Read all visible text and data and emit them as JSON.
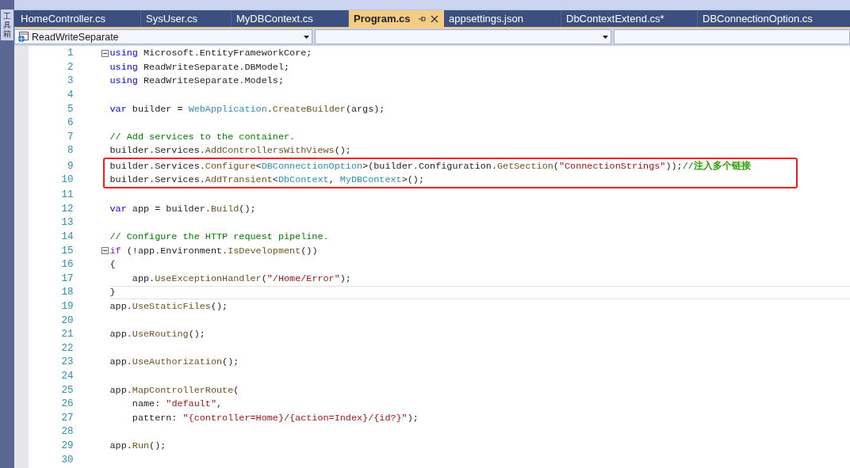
{
  "side_panel": {
    "label": "工具箱"
  },
  "tabs": [
    {
      "label": "HomeController.cs",
      "selected": false
    },
    {
      "label": "SysUser.cs",
      "selected": false
    },
    {
      "label": "MyDBContext.cs",
      "selected": false
    },
    {
      "label": "Program.cs",
      "selected": true
    },
    {
      "label": "appsettings.json",
      "selected": false
    },
    {
      "label": "DbContextExtend.cs*",
      "selected": false
    },
    {
      "label": "DBConnectionOption.cs",
      "selected": false
    }
  ],
  "navigation_bar": {
    "project": "ReadWriteSeparate"
  },
  "blocks": [
    {
      "highlighted": false,
      "lines": [
        {
          "number": "1",
          "fold": true,
          "current": false,
          "tokens": [
            {
              "kind": "keyword",
              "text": "using"
            },
            {
              "kind": "plain",
              "text": " Microsoft.EntityFrameworkCore;"
            }
          ]
        },
        {
          "number": "2",
          "fold": false,
          "current": false,
          "tokens": [
            {
              "kind": "keyword",
              "text": "using"
            },
            {
              "kind": "plain",
              "text": " ReadWriteSeparate.DBModel;"
            }
          ]
        },
        {
          "number": "3",
          "fold": false,
          "current": false,
          "tokens": [
            {
              "kind": "keyword",
              "text": "using"
            },
            {
              "kind": "plain",
              "text": " ReadWriteSeparate.Models;"
            }
          ]
        },
        {
          "number": "4",
          "fold": false,
          "current": false
        },
        {
          "number": "5",
          "fold": false,
          "current": false,
          "tokens": [
            {
              "kind": "keyword",
              "text": "var"
            },
            {
              "kind": "plain",
              "text": " builder = "
            },
            {
              "kind": "type",
              "text": "WebApplication"
            },
            {
              "kind": "plain",
              "text": "."
            },
            {
              "kind": "method",
              "text": "CreateBuilder"
            },
            {
              "kind": "plain",
              "text": "(args);"
            }
          ]
        },
        {
          "number": "6",
          "fold": false,
          "current": false
        },
        {
          "number": "7",
          "fold": false,
          "current": false,
          "tokens": [
            {
              "kind": "comment",
              "text": "// Add services to the container."
            }
          ]
        },
        {
          "number": "8",
          "fold": false,
          "current": false,
          "tokens": [
            {
              "kind": "plain",
              "text": "builder.Services."
            },
            {
              "kind": "method",
              "text": "AddControllersWithViews"
            },
            {
              "kind": "plain",
              "text": "();"
            }
          ]
        }
      ]
    },
    {
      "highlighted": true,
      "lines": [
        {
          "number": "9",
          "fold": false,
          "current": false,
          "tokens": [
            {
              "kind": "plain",
              "text": "builder.Services."
            },
            {
              "kind": "method",
              "text": "Configure"
            },
            {
              "kind": "plain",
              "text": "<"
            },
            {
              "kind": "type",
              "text": "DBConnectionOption"
            },
            {
              "kind": "plain",
              "text": ">(builder.Configuration."
            },
            {
              "kind": "method",
              "text": "GetSection"
            },
            {
              "kind": "plain",
              "text": "("
            },
            {
              "kind": "string",
              "text": "\"ConnectionStrings\""
            },
            {
              "kind": "plain",
              "text": "));"
            },
            {
              "kind": "comment",
              "text": "//"
            },
            {
              "kind": "note",
              "text": "注入多个链接"
            }
          ]
        },
        {
          "number": "10",
          "fold": false,
          "current": false,
          "tokens": [
            {
              "kind": "plain",
              "text": "builder.Services."
            },
            {
              "kind": "method",
              "text": "AddTransient"
            },
            {
              "kind": "plain",
              "text": "<"
            },
            {
              "kind": "type",
              "text": "DbContext"
            },
            {
              "kind": "plain",
              "text": ", "
            },
            {
              "kind": "type",
              "text": "MyDBContext"
            },
            {
              "kind": "plain",
              "text": ">();"
            }
          ]
        }
      ]
    },
    {
      "highlighted": false,
      "lines": [
        {
          "number": "11",
          "fold": false,
          "current": false
        },
        {
          "number": "12",
          "fold": false,
          "current": false,
          "tokens": [
            {
              "kind": "keyword",
              "text": "var"
            },
            {
              "kind": "plain",
              "text": " app = builder."
            },
            {
              "kind": "method",
              "text": "Build"
            },
            {
              "kind": "plain",
              "text": "();"
            }
          ]
        },
        {
          "number": "13",
          "fold": false,
          "current": false
        },
        {
          "number": "14",
          "fold": false,
          "current": false,
          "tokens": [
            {
              "kind": "comment",
              "text": "// Configure the HTTP request pipeline."
            }
          ]
        },
        {
          "number": "15",
          "fold": true,
          "current": false,
          "tokens": [
            {
              "kind": "control",
              "text": "if"
            },
            {
              "kind": "plain",
              "text": " (!app.Environment."
            },
            {
              "kind": "method",
              "text": "IsDevelopment"
            },
            {
              "kind": "plain",
              "text": "())"
            }
          ]
        },
        {
          "number": "16",
          "fold": false,
          "current": false,
          "tokens": [
            {
              "kind": "plain",
              "text": "{"
            }
          ]
        },
        {
          "number": "17",
          "fold": false,
          "current": false,
          "tokens": [
            {
              "kind": "plain",
              "text": "    app."
            },
            {
              "kind": "method",
              "text": "UseExceptionHandler"
            },
            {
              "kind": "plain",
              "text": "("
            },
            {
              "kind": "string",
              "text": "\"/Home/Error\""
            },
            {
              "kind": "plain",
              "text": ");"
            }
          ]
        },
        {
          "number": "18",
          "fold": false,
          "current": true,
          "tokens": [
            {
              "kind": "plain",
              "text": "}"
            }
          ]
        },
        {
          "number": "19",
          "fold": false,
          "current": false,
          "tokens": [
            {
              "kind": "plain",
              "text": "app."
            },
            {
              "kind": "method",
              "text": "UseStaticFiles"
            },
            {
              "kind": "plain",
              "text": "();"
            }
          ]
        },
        {
          "number": "20",
          "fold": false,
          "current": false
        },
        {
          "number": "21",
          "fold": false,
          "current": false,
          "tokens": [
            {
              "kind": "plain",
              "text": "app."
            },
            {
              "kind": "method",
              "text": "UseRouting"
            },
            {
              "kind": "plain",
              "text": "();"
            }
          ]
        },
        {
          "number": "22",
          "fold": false,
          "current": false
        },
        {
          "number": "23",
          "fold": false,
          "current": false,
          "tokens": [
            {
              "kind": "plain",
              "text": "app."
            },
            {
              "kind": "method",
              "text": "UseAuthorization"
            },
            {
              "kind": "plain",
              "text": "();"
            }
          ]
        },
        {
          "number": "24",
          "fold": false,
          "current": false
        },
        {
          "number": "25",
          "fold": false,
          "current": false,
          "tokens": [
            {
              "kind": "plain",
              "text": "app."
            },
            {
              "kind": "method",
              "text": "MapControllerRoute"
            },
            {
              "kind": "plain",
              "text": "("
            }
          ]
        },
        {
          "number": "26",
          "fold": false,
          "current": false,
          "tokens": [
            {
              "kind": "plain",
              "text": "    name: "
            },
            {
              "kind": "string",
              "text": "\"default\""
            },
            {
              "kind": "plain",
              "text": ","
            }
          ]
        },
        {
          "number": "27",
          "fold": false,
          "current": false,
          "tokens": [
            {
              "kind": "plain",
              "text": "    pattern: "
            },
            {
              "kind": "string",
              "text": "\"{controller=Home}/{action=Index}/{id?}\""
            },
            {
              "kind": "plain",
              "text": ");"
            }
          ]
        },
        {
          "number": "28",
          "fold": false,
          "current": false
        },
        {
          "number": "29",
          "fold": false,
          "current": false,
          "tokens": [
            {
              "kind": "plain",
              "text": "app."
            },
            {
              "kind": "method",
              "text": "Run"
            },
            {
              "kind": "plain",
              "text": "();"
            }
          ]
        },
        {
          "number": "30",
          "fold": false,
          "current": false
        }
      ]
    }
  ]
}
